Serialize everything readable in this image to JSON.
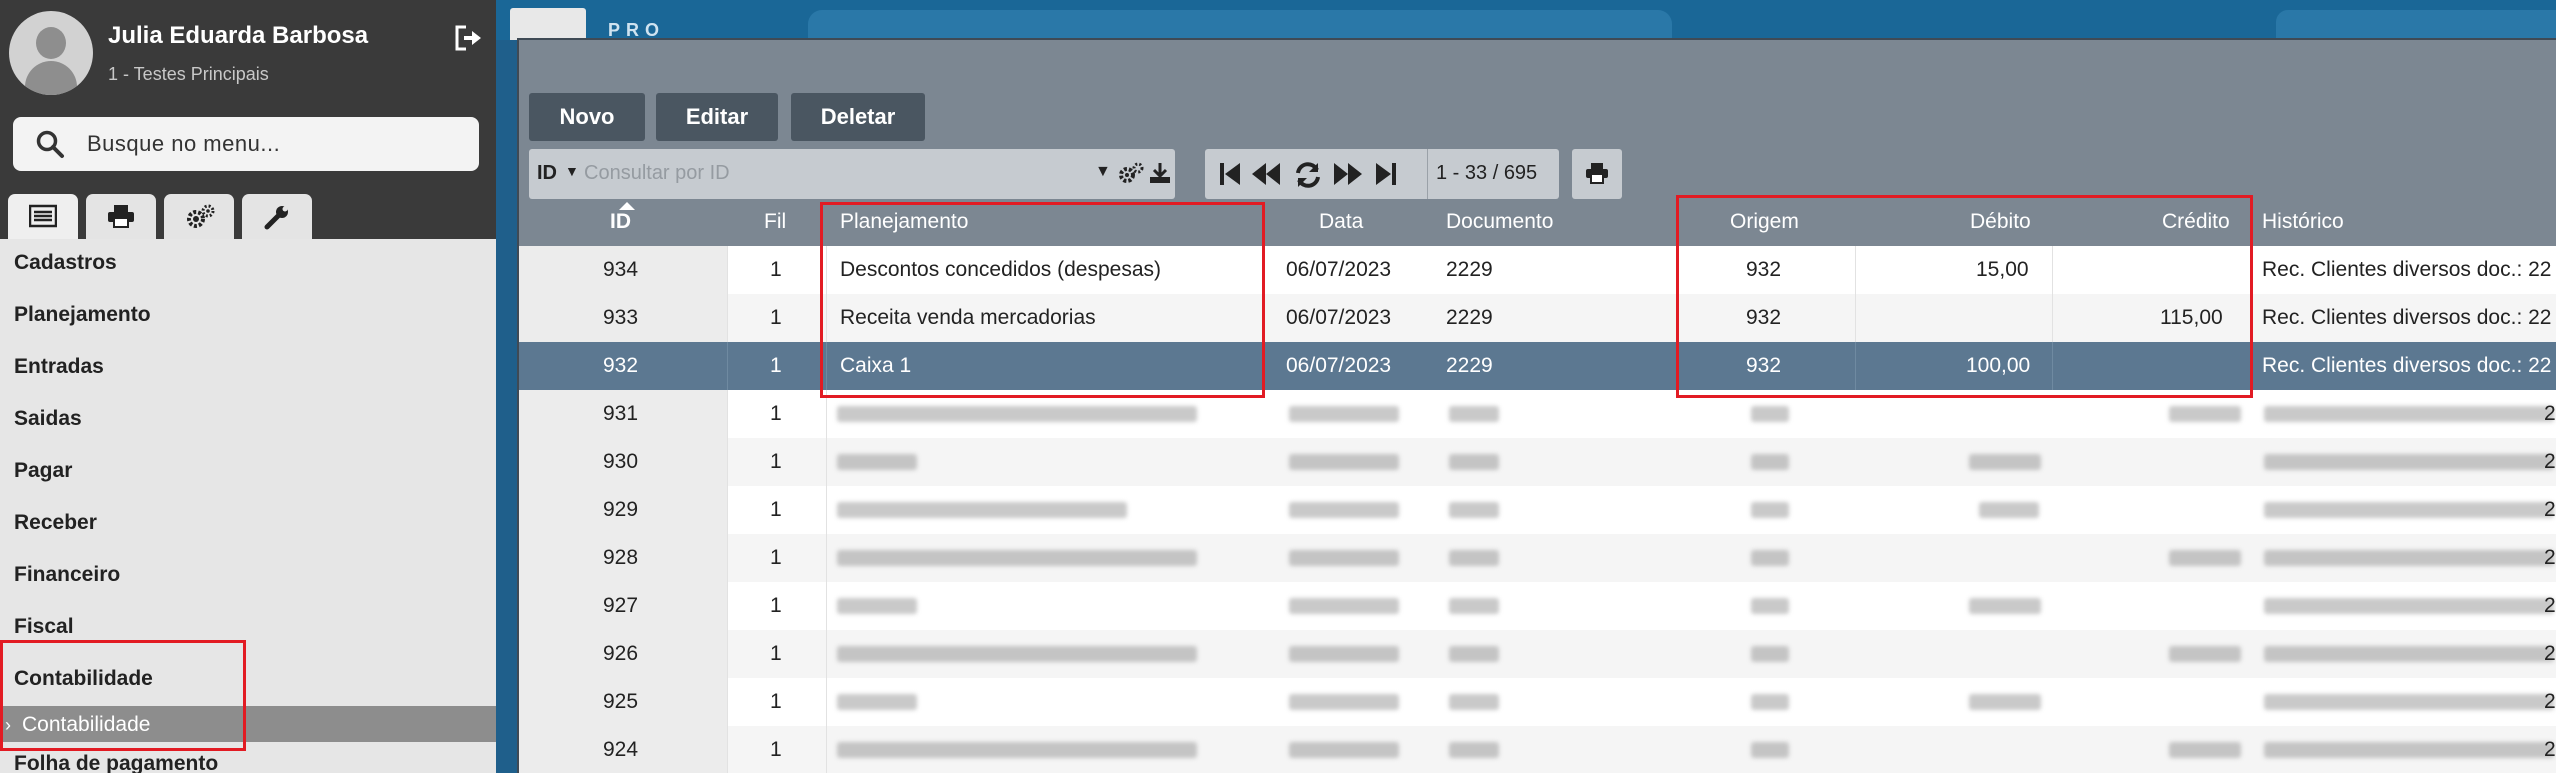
{
  "user": {
    "name": "Julia Eduarda Barbosa",
    "org": "1 - Testes Principais"
  },
  "search": {
    "placeholder": "Busque no menu..."
  },
  "sidebar_tabs": [
    "list-icon",
    "print-icon",
    "gears-icon",
    "wrench-icon"
  ],
  "menu": {
    "items": [
      "Cadastros",
      "Planejamento",
      "Entradas",
      "Saidas",
      "Pagar",
      "Receber",
      "Financeiro",
      "Fiscal",
      "Contabilidade"
    ],
    "sub_item": "Contabilidade",
    "last_item": "Folha de pagamento"
  },
  "app": {
    "brand": "PRO"
  },
  "toolbar": {
    "new": "Novo",
    "edit": "Editar",
    "delete": "Deletar"
  },
  "query": {
    "field": "ID",
    "placeholder": "Consultar por ID"
  },
  "pager": {
    "range": "1 - 33 / 695"
  },
  "table": {
    "columns": [
      "ID",
      "Fil",
      "Planejamento",
      "Data",
      "Documento",
      "Origem",
      "Débito",
      "Crédito",
      "Histórico"
    ],
    "rows": [
      {
        "id": "934",
        "fil": "1",
        "planejamento": "Descontos concedidos (despesas)",
        "data": "06/07/2023",
        "documento": "2229",
        "origem": "932",
        "debito": "15,00",
        "credito": "",
        "historico": "Rec. Clientes diversos doc.: 22"
      },
      {
        "id": "933",
        "fil": "1",
        "planejamento": "Receita venda mercadorias",
        "data": "06/07/2023",
        "documento": "2229",
        "origem": "932",
        "debito": "",
        "credito": "115,00",
        "historico": "Rec. Clientes diversos doc.: 22"
      },
      {
        "id": "932",
        "fil": "1",
        "planejamento": "Caixa 1",
        "data": "06/07/2023",
        "documento": "2229",
        "origem": "932",
        "debito": "100,00",
        "credito": "",
        "historico": "Rec. Clientes diversos doc.: 22",
        "selected": true
      },
      {
        "id": "931",
        "fil": "1",
        "tail": "2"
      },
      {
        "id": "930",
        "fil": "1",
        "tail": "2"
      },
      {
        "id": "929",
        "fil": "1",
        "tail": "2"
      },
      {
        "id": "928",
        "fil": "1",
        "tail": "2"
      },
      {
        "id": "927",
        "fil": "1",
        "tail": "2"
      },
      {
        "id": "926",
        "fil": "1",
        "tail": "2"
      },
      {
        "id": "925",
        "fil": "1",
        "tail": "2"
      },
      {
        "id": "924",
        "fil": "1",
        "tail": "2"
      }
    ]
  },
  "colors": {
    "highlight": "#e21b23",
    "selected_row": "#5c7891",
    "panel": "#7c8792"
  }
}
